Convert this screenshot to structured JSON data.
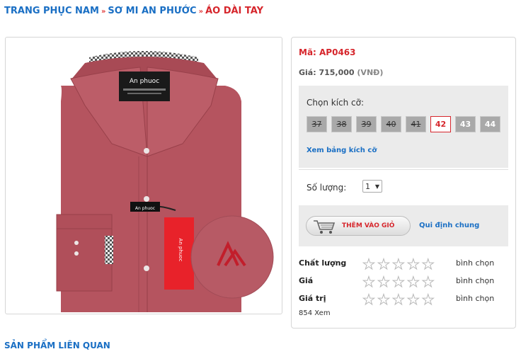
{
  "breadcrumb": {
    "items": [
      "TRANG PHỤC NAM",
      "SƠ MI AN PHƯỚC"
    ],
    "separator": "»",
    "current": "ÁO DÀI TAY"
  },
  "product": {
    "code_label": "Mã: AP0463",
    "price_label": "Giá: 715,000",
    "price_currency": "(VNĐ)",
    "image_brand": "An phuoc",
    "tag_brand": "An phuoc"
  },
  "sizes": {
    "title": "Chọn kích cỡ:",
    "options": [
      {
        "label": "37",
        "state": "unavailable"
      },
      {
        "label": "38",
        "state": "unavailable"
      },
      {
        "label": "39",
        "state": "unavailable"
      },
      {
        "label": "40",
        "state": "unavailable"
      },
      {
        "label": "41",
        "state": "unavailable"
      },
      {
        "label": "42",
        "state": "selected"
      },
      {
        "label": "43",
        "state": "available"
      },
      {
        "label": "44",
        "state": "available"
      }
    ],
    "guide_link": "Xem bảng kích cỡ"
  },
  "quantity": {
    "label": "Số lượng:",
    "value": "1"
  },
  "cart": {
    "add_label": "THÊM VÀO GIỎ",
    "policy_link": "Qui định chung"
  },
  "ratings": [
    {
      "name": "Chất lượng",
      "stars": 0,
      "vote": "bình chọn"
    },
    {
      "name": "Giá",
      "stars": 0,
      "vote": "bình chọn"
    },
    {
      "name": "Giá trị",
      "stars": 0,
      "vote": "bình chọn"
    }
  ],
  "views": "854 Xem",
  "related_title": "SẢN PHẨM LIÊN QUAN",
  "colors": {
    "link": "#1a6fc4",
    "accent_red": "#d6262c",
    "shirt": "#b5545f",
    "panel_bg": "#ebebeb"
  }
}
